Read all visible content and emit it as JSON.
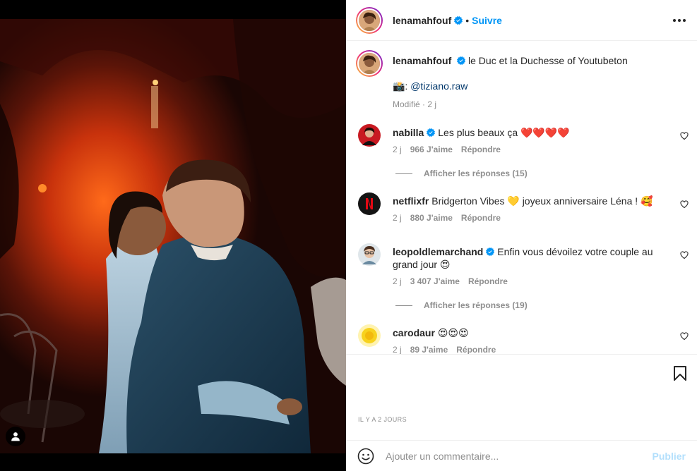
{
  "post": {
    "author": "lenamahfouf",
    "follow_label": "Suivre",
    "dot": "•",
    "caption_text": "le Duc et la Duchesse of Youtubeton",
    "caption_camera": "📸: ",
    "caption_mention": "@tiziano.raw",
    "caption_meta": "Modifié · 2 j",
    "timestamp": "IL Y A 2 JOURS"
  },
  "comments": [
    {
      "user": "nabilla",
      "verified": true,
      "text": "Les plus beaux ça ❤️❤️❤️❤️",
      "age": "2 j",
      "likes": "966 J'aime",
      "reply": "Répondre",
      "replies": "Afficher les réponses (15)"
    },
    {
      "user": "netflixfr",
      "verified": false,
      "text": "Bridgerton Vibes 💛 joyeux anniversaire Léna ! 🥰",
      "age": "2 j",
      "likes": "880 J'aime",
      "reply": "Répondre"
    },
    {
      "user": "leopoldlemarchand",
      "verified": true,
      "text": "Enfin vous dévoilez votre couple au grand jour 😍",
      "age": "2 j",
      "likes": "3 407 J'aime",
      "reply": "Répondre",
      "replies": "Afficher les réponses (19)"
    },
    {
      "user": "carodaur",
      "verified": false,
      "text": "😍😍😍",
      "age": "2 j",
      "likes": "89 J'aime",
      "reply": "Répondre"
    }
  ],
  "add_comment": {
    "placeholder": "Ajouter un commentaire...",
    "publish_label": "Publier"
  },
  "icons": {
    "verified": "verified-badge-icon",
    "more": "more-options-icon",
    "heart": "heart-icon",
    "bookmark": "bookmark-icon",
    "emoji": "emoji-icon",
    "tag": "user-tag-icon"
  },
  "colors": {
    "accent": "#0095f6",
    "link": "#00376b",
    "muted": "#8e8e8e",
    "publish_disabled": "#b2dffc"
  }
}
